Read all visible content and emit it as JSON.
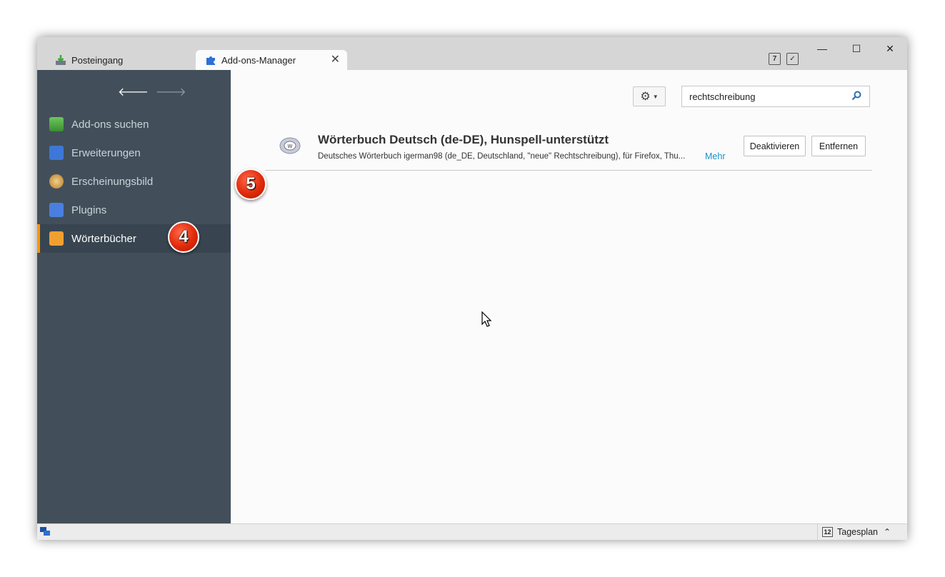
{
  "tabs": [
    {
      "label": "Posteingang",
      "icon": "inbox-download-icon"
    },
    {
      "label": "Add-ons-Manager",
      "icon": "puzzle-icon",
      "close": "✕"
    }
  ],
  "window_controls": {
    "minimize": "—",
    "maximize": "☐",
    "close": "✕"
  },
  "toolbar_icons": {
    "calendar_day": "7"
  },
  "sidebar": {
    "back": "🡐",
    "forward": "🡒",
    "items": [
      {
        "label": "Add-ons suchen",
        "icon": "get-addons-icon",
        "color": "#5fb84a"
      },
      {
        "label": "Erweiterungen",
        "icon": "extensions-puzzle-icon",
        "color": "#3d77d8"
      },
      {
        "label": "Erscheinungsbild",
        "icon": "appearance-palette-icon",
        "color": "#d7a24a"
      },
      {
        "label": "Plugins",
        "icon": "plugins-brick-icon",
        "color": "#4a7fe0"
      },
      {
        "label": "Wörterbücher",
        "icon": "dictionary-book-icon",
        "color": "#f0a030",
        "selected": true
      }
    ]
  },
  "annotations": {
    "badge_sidebar": "4",
    "badge_row": "5"
  },
  "search": {
    "value": "rechtschreibung",
    "placeholder": ""
  },
  "addon": {
    "title": "Wörterbuch Deutsch (de-DE), Hunspell-unterstützt",
    "description": "Deutsches Wörterbuch igerman98 (de_DE, Deutschland, \"neue\" Rechtschreibung), für Firefox, Thu...",
    "more": "Mehr",
    "disable_button": "Deaktivieren",
    "remove_button": "Entfernen"
  },
  "statusbar": {
    "tagesplan": "Tagesplan",
    "calendar_day": "12",
    "chevron": "⌃"
  },
  "colors": {
    "sidebar": "#424f5a",
    "selected_accent": "#ff9500",
    "link": "#1e90c8",
    "badge": "#e02a0a"
  }
}
